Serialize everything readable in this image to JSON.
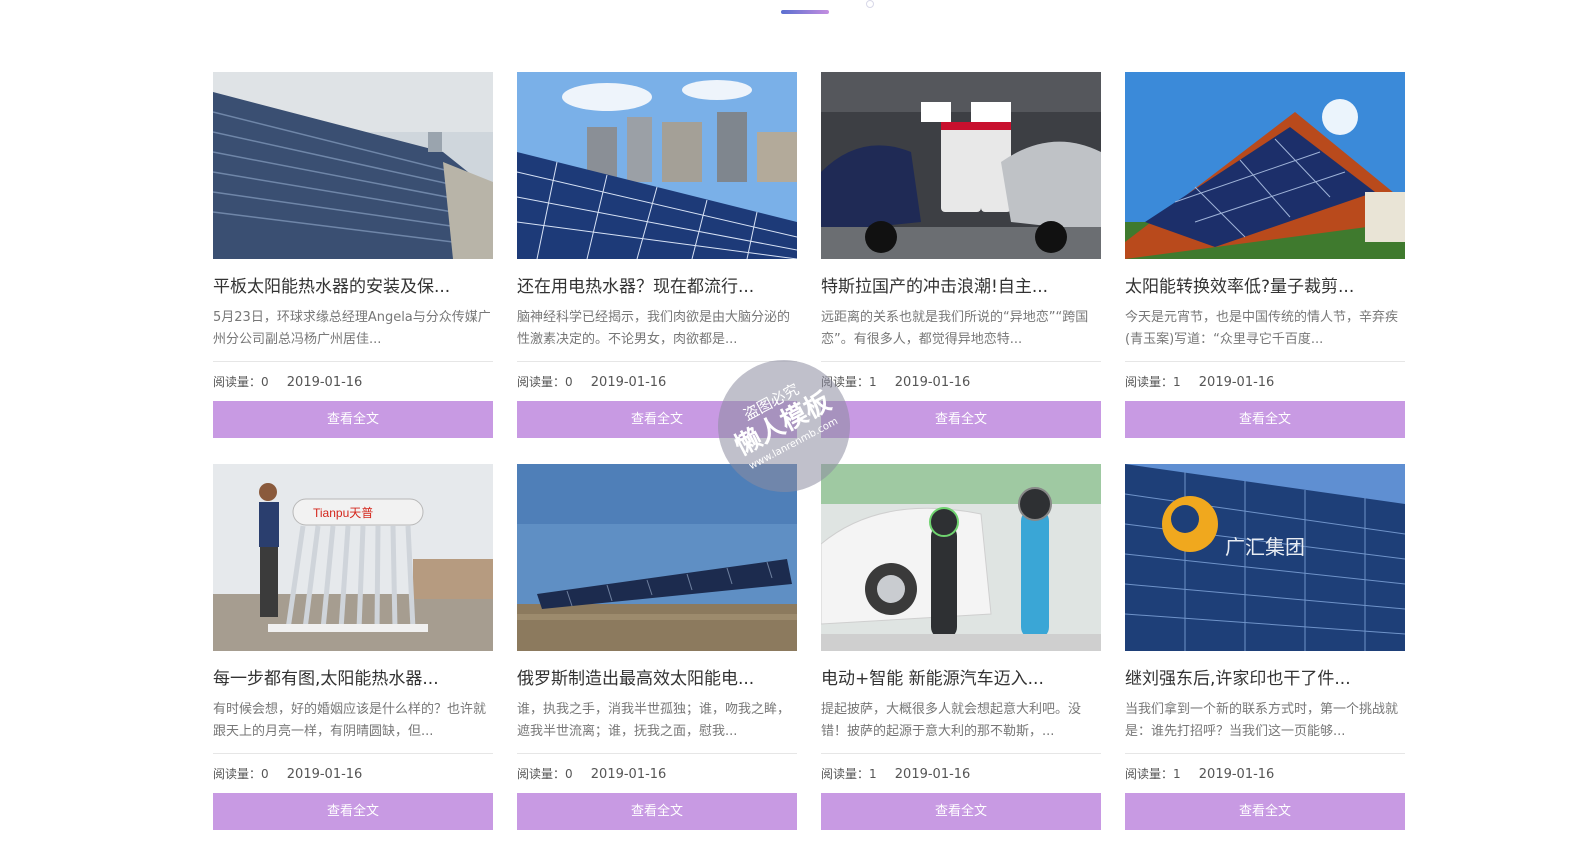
{
  "theme": {
    "accent": "#c89ae3",
    "indicator_from": "#5a6fd0",
    "indicator_to": "#c48ee0"
  },
  "watermark": {
    "line1": "盗图必究",
    "line2": "懒人模板",
    "line3": "www.lanrenmb.com"
  },
  "cards": [
    {
      "title": "平板太阳能热水器的安装及保...",
      "summary": "5月23日，环球求缘总经理Angela与分众传媒广州分公司副总冯杨广州居佳...",
      "reads_label": "阅读量：0",
      "date": "2019-01-16",
      "button": "查看全文",
      "image": "solar-water-heater-roof"
    },
    {
      "title": "还在用电热水器？现在都流行...",
      "summary": "脑神经科学已经揭示，我们肉欲是由大脑分泌的性激素决定的。不论男女，肉欲都是...",
      "reads_label": "阅读量：0",
      "date": "2019-01-16",
      "button": "查看全文",
      "image": "solar-panels-city"
    },
    {
      "title": "特斯拉国产的冲击浪潮!自主...",
      "summary": "远距离的关系也就是我们所说的“异地恋”“跨国恋”。有很多人，都觉得异地恋特...",
      "reads_label": "阅读量：1",
      "date": "2019-01-16",
      "button": "查看全文",
      "image": "tesla-charging-station"
    },
    {
      "title": "太阳能转换效率低?量子裁剪...",
      "summary": "今天是元宵节，也是中国传统的情人节，辛弃疾(青玉案)写道：“众里寻它千百度...",
      "reads_label": "阅读量：1",
      "date": "2019-01-16",
      "button": "查看全文",
      "image": "solar-roof-house"
    },
    {
      "title": "每一步都有图,太阳能热水器...",
      "summary": "有时候会想，好的婚姻应该是什么样的？也许就跟天上的月亮一样，有阴晴圆缺，但...",
      "reads_label": "阅读量：0",
      "date": "2019-01-16",
      "button": "查看全文",
      "image": "installing-water-heater",
      "logo_text": "Tianpu天普"
    },
    {
      "title": "俄罗斯制造出最高效太阳能电...",
      "summary": "谁，执我之手，消我半世孤独；谁，吻我之眸，遮我半世流离；谁，抚我之面，慰我...",
      "reads_label": "阅读量：0",
      "date": "2019-01-16",
      "button": "查看全文",
      "image": "solar-farm-field"
    },
    {
      "title": "电动+智能 新能源汽车迈入...",
      "summary": "提起披萨，大概很多人就会想起意大利吧。没错！披萨的起源于意大利的那不勒斯，...",
      "reads_label": "阅读量：1",
      "date": "2019-01-16",
      "button": "查看全文",
      "image": "ev-charger-car"
    },
    {
      "title": "继刘强东后,许家印也干了件...",
      "summary": "当我们拿到一个新的联系方式时，第一个挑战就是：谁先打招呼？当我们这一页能够...",
      "reads_label": "阅读量：1",
      "date": "2019-01-16",
      "button": "查看全文",
      "image": "glass-building-logo",
      "logo_text": "广汇集团"
    }
  ]
}
